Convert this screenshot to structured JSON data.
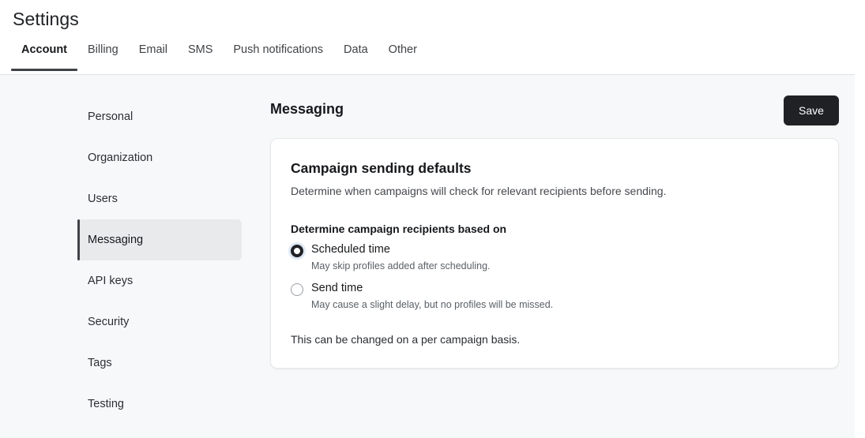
{
  "header": {
    "title": "Settings",
    "tabs": [
      {
        "label": "Account",
        "active": true
      },
      {
        "label": "Billing",
        "active": false
      },
      {
        "label": "Email",
        "active": false
      },
      {
        "label": "SMS",
        "active": false
      },
      {
        "label": "Push notifications",
        "active": false
      },
      {
        "label": "Data",
        "active": false
      },
      {
        "label": "Other",
        "active": false
      }
    ]
  },
  "sidebar": {
    "items": [
      {
        "label": "Personal",
        "active": false
      },
      {
        "label": "Organization",
        "active": false
      },
      {
        "label": "Users",
        "active": false
      },
      {
        "label": "Messaging",
        "active": true
      },
      {
        "label": "API keys",
        "active": false
      },
      {
        "label": "Security",
        "active": false
      },
      {
        "label": "Tags",
        "active": false
      },
      {
        "label": "Testing",
        "active": false
      }
    ]
  },
  "main": {
    "section_title": "Messaging",
    "save_label": "Save",
    "card": {
      "title": "Campaign sending defaults",
      "description": "Determine when campaigns will check for relevant recipients before sending.",
      "field_label": "Determine campaign recipients based on",
      "options": [
        {
          "label": "Scheduled time",
          "help": "May skip profiles added after scheduling.",
          "checked": true
        },
        {
          "label": "Send time",
          "help": "May cause a slight delay, but no profiles will be missed.",
          "checked": false
        }
      ],
      "note": "This can be changed on a per campaign basis."
    }
  },
  "colors": {
    "page_background": "#f7f8f9",
    "header_background": "#ffffff",
    "accent_dark": "#1f2125",
    "active_nav_background": "#e9eaec",
    "focus_ring": "#dfe9f5"
  }
}
